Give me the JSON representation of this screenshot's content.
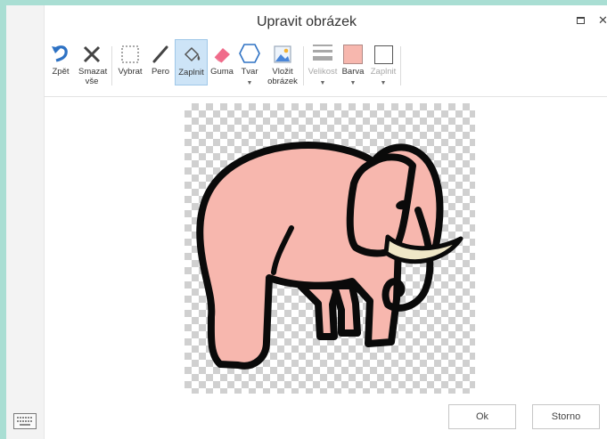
{
  "dialog": {
    "title": "Upravit obrázek"
  },
  "toolbar": {
    "undo": "Zpět",
    "clear": "Smazat vše",
    "select": "Vybrat",
    "pen": "Pero",
    "fill": "Zaplnit",
    "eraser": "Guma",
    "shape": "Tvar",
    "insert_image": "Vložit obrázek",
    "size": "Velikost",
    "color": "Barva",
    "fill_toggle": "Zaplnit",
    "active_tool": "Zaplnit",
    "current_color": "#f7b7ae"
  },
  "footer": {
    "ok": "Ok",
    "cancel": "Storno"
  },
  "icons": [
    "undo-icon",
    "clear-icon",
    "select-icon",
    "pen-icon",
    "fill-icon",
    "eraser-icon",
    "shape-icon",
    "insert-image-icon",
    "size-icon",
    "color-swatch-icon",
    "fill-toggle-icon",
    "keyboard-icon",
    "maximize-icon",
    "close-icon"
  ]
}
